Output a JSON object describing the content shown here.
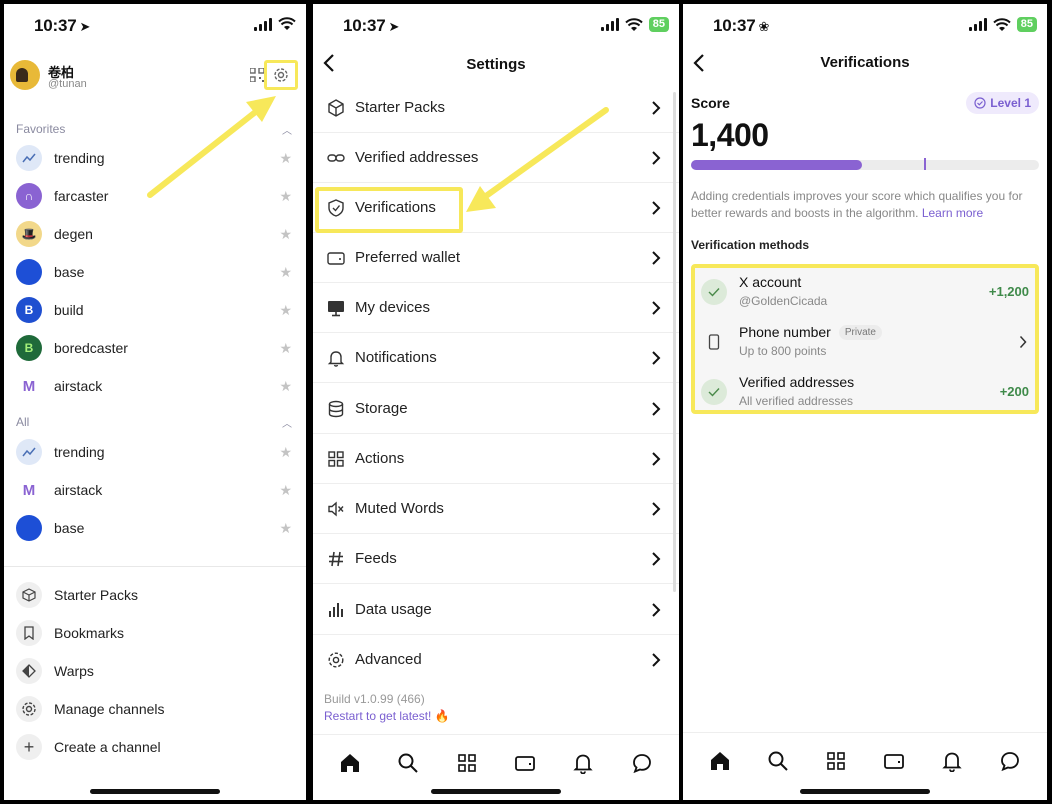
{
  "status_bar": {
    "p1_time": "10:37",
    "p2_time": "10:37",
    "p3_time": "10:37",
    "battery": "85"
  },
  "profile": {
    "name": "卷柏",
    "handle": "@tunan"
  },
  "favorites": {
    "title": "Favorites",
    "items": [
      {
        "label": "trending",
        "icon": "trending-icon"
      },
      {
        "label": "farcaster",
        "icon": "farcaster-icon"
      },
      {
        "label": "degen",
        "icon": "degen-icon"
      },
      {
        "label": "base",
        "icon": "base-icon"
      },
      {
        "label": "build",
        "icon": "build-icon"
      },
      {
        "label": "boredcaster",
        "icon": "boredcaster-icon"
      },
      {
        "label": "airstack",
        "icon": "airstack-icon"
      }
    ]
  },
  "all_channels": {
    "title": "All",
    "items": [
      {
        "label": "trending",
        "icon": "trending-icon"
      },
      {
        "label": "airstack",
        "icon": "airstack-icon"
      },
      {
        "label": "base",
        "icon": "base-icon"
      }
    ]
  },
  "drawer_menu": [
    {
      "label": "Starter Packs",
      "icon": "cube-icon"
    },
    {
      "label": "Bookmarks",
      "icon": "bookmark-icon"
    },
    {
      "label": "Warps",
      "icon": "warps-icon"
    },
    {
      "label": "Manage channels",
      "icon": "gear-icon"
    },
    {
      "label": "Create a channel",
      "icon": "plus-icon"
    }
  ],
  "settings": {
    "title": "Settings",
    "items": [
      {
        "label": "Starter Packs",
        "icon": "cube-icon"
      },
      {
        "label": "Verified addresses",
        "icon": "link-icon"
      },
      {
        "label": "Verifications",
        "icon": "shield-check-icon"
      },
      {
        "label": "Preferred wallet",
        "icon": "wallet-icon"
      },
      {
        "label": "My devices",
        "icon": "monitor-icon"
      },
      {
        "label": "Notifications",
        "icon": "bell-icon"
      },
      {
        "label": "Storage",
        "icon": "database-icon"
      },
      {
        "label": "Actions",
        "icon": "grid-icon"
      },
      {
        "label": "Muted Words",
        "icon": "mute-icon"
      },
      {
        "label": "Feeds",
        "icon": "hash-icon"
      },
      {
        "label": "Data usage",
        "icon": "bar-chart-icon"
      },
      {
        "label": "Advanced",
        "icon": "gear-icon"
      }
    ],
    "build": "Build v1.0.99 (466)",
    "restart": "Restart to get latest! 🔥"
  },
  "verifications": {
    "title": "Verifications",
    "score_label": "Score",
    "score": "1,400",
    "level": "Level 1",
    "progress_fraction": 0.49,
    "marker_fraction": 0.67,
    "description": "Adding credentials improves your score which qualifies you for better rewards and boosts in the algorithm.",
    "learn_more": "Learn more",
    "methods_title": "Verification methods",
    "methods": [
      {
        "name": "X account",
        "sub": "@GoldenCicada",
        "points": "+1,200",
        "badge": ""
      },
      {
        "name": "Phone number",
        "sub": "Up to 800 points",
        "points": "",
        "badge": "Private"
      },
      {
        "name": "Verified addresses",
        "sub": "All verified addresses",
        "points": "+200",
        "badge": ""
      }
    ]
  },
  "colors": {
    "accent": "#8a63d2",
    "highlight": "#f7e85a",
    "success": "#3f8a4a"
  }
}
